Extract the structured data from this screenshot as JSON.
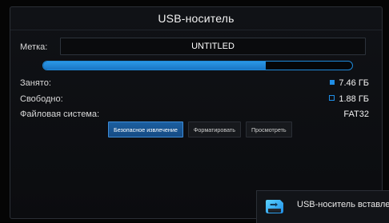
{
  "dialog": {
    "title": "USB-носитель"
  },
  "label_field": {
    "label": "Метка:",
    "value": "UNTITLED"
  },
  "usage": {
    "used_fraction": 0.72,
    "accent_color": "#1f8ee6"
  },
  "details": {
    "used_label": "Занято:",
    "used_value": "7.46 ГБ",
    "free_label": "Свободно:",
    "free_value": "1.88 ГБ",
    "fs_label": "Файловая система:",
    "fs_value": "FAT32"
  },
  "actions": {
    "eject": "Безопасное извлечение",
    "format": "Форматировать",
    "browse": "Просмотреть"
  },
  "notification": {
    "text": "USB-носитель вставлен",
    "icon": "usb-drive-icon"
  }
}
